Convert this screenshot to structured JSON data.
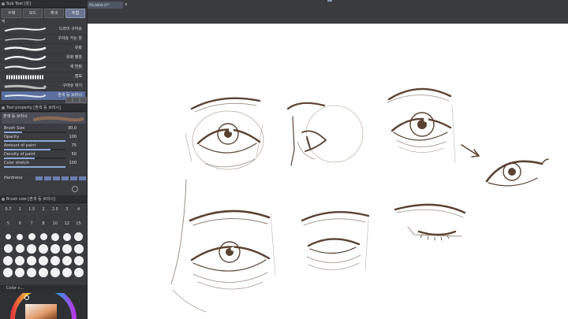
{
  "sub_tool": {
    "title": "Sub Tool [붓]",
    "tabs": [
      "수채",
      "보드",
      "채색",
      "두껍"
    ],
    "active_tab": 3,
    "subrow": "먹",
    "brushes": [
      "드라이 구아슈",
      "구아슈 가는 붓",
      "유화",
      "유화 평붓",
      "색 번짐",
      "점묘",
      "구아슈 섞기",
      "혼색 둥 브러시"
    ],
    "selected_brush": 7
  },
  "tool_property": {
    "title": "Tool property [혼색 둥 브러시]",
    "preset_name": "혼색 둥 브러시",
    "properties": [
      {
        "label": "Brush Size",
        "value": "30.0",
        "level": 0.3
      },
      {
        "label": "Opacity",
        "value": "100",
        "level": 1.0
      },
      {
        "label": "Amount of paint",
        "value": "75",
        "level": 0.75
      },
      {
        "label": "Density of paint",
        "value": "50",
        "level": 0.5
      },
      {
        "label": "Color stretch",
        "value": "100",
        "level": 1.0
      }
    ],
    "hardness_label": "Hardness"
  },
  "brush_size": {
    "title": "Brush size [혼색 둥 브러시]",
    "row1": [
      "0.7",
      "1",
      "1.5",
      "2",
      "2.5",
      "3",
      "4"
    ],
    "row2": [
      "5",
      "6",
      "7",
      "8",
      "10",
      "12",
      "15"
    ]
  },
  "color_panel": {
    "title": "Color c..."
  },
  "document": {
    "tab_label": "PDLNEW-07*",
    "close": "×"
  },
  "colors": {
    "ui_bg": "#3b3c40",
    "selection": "#5a6f9d",
    "slider": "#8ca7d6",
    "sketch": "#5a4233"
  }
}
